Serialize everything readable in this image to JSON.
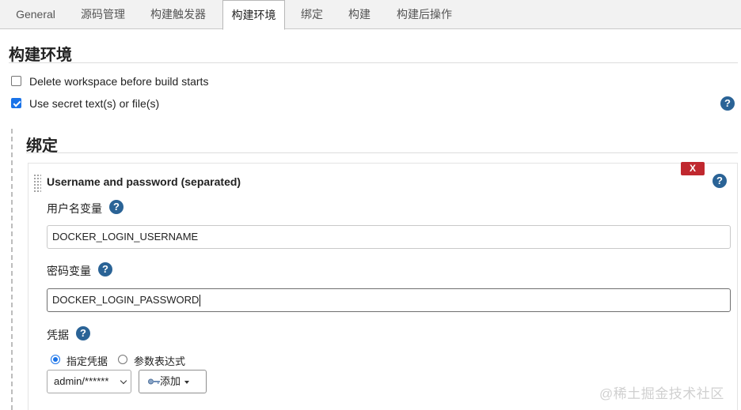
{
  "tabs": [
    {
      "label": "General",
      "active": false
    },
    {
      "label": "源码管理",
      "active": false
    },
    {
      "label": "构建触发器",
      "active": false
    },
    {
      "label": "构建环境",
      "active": true
    },
    {
      "label": "绑定",
      "active": false
    },
    {
      "label": "构建",
      "active": false
    },
    {
      "label": "构建后操作",
      "active": false
    }
  ],
  "build_env": {
    "title": "构建环境",
    "delete_workspace_label": "Delete workspace before build starts",
    "delete_workspace_checked": false,
    "use_secret_label": "Use secret text(s) or file(s)",
    "use_secret_checked": true
  },
  "bindings": {
    "title": "绑定",
    "item": {
      "title": "Username and password (separated)",
      "delete_label": "X",
      "username_var_label": "用户名变量",
      "username_var_value": "DOCKER_LOGIN_USERNAME",
      "password_var_label": "密码变量",
      "password_var_value": "DOCKER_LOGIN_PASSWORD",
      "credentials_label": "凭据",
      "radio_specific_label": "指定凭据",
      "radio_specific_checked": true,
      "radio_expression_label": "参数表达式",
      "radio_expression_checked": false,
      "credential_selected": "admin/******",
      "add_button_label": "添加"
    }
  },
  "help_symbol": "?",
  "watermark": "@稀土掘金技术社区",
  "colors": {
    "help_icon": "#2a6396",
    "delete_button": "#c0282f",
    "checkbox_accent": "#1a73e8"
  }
}
